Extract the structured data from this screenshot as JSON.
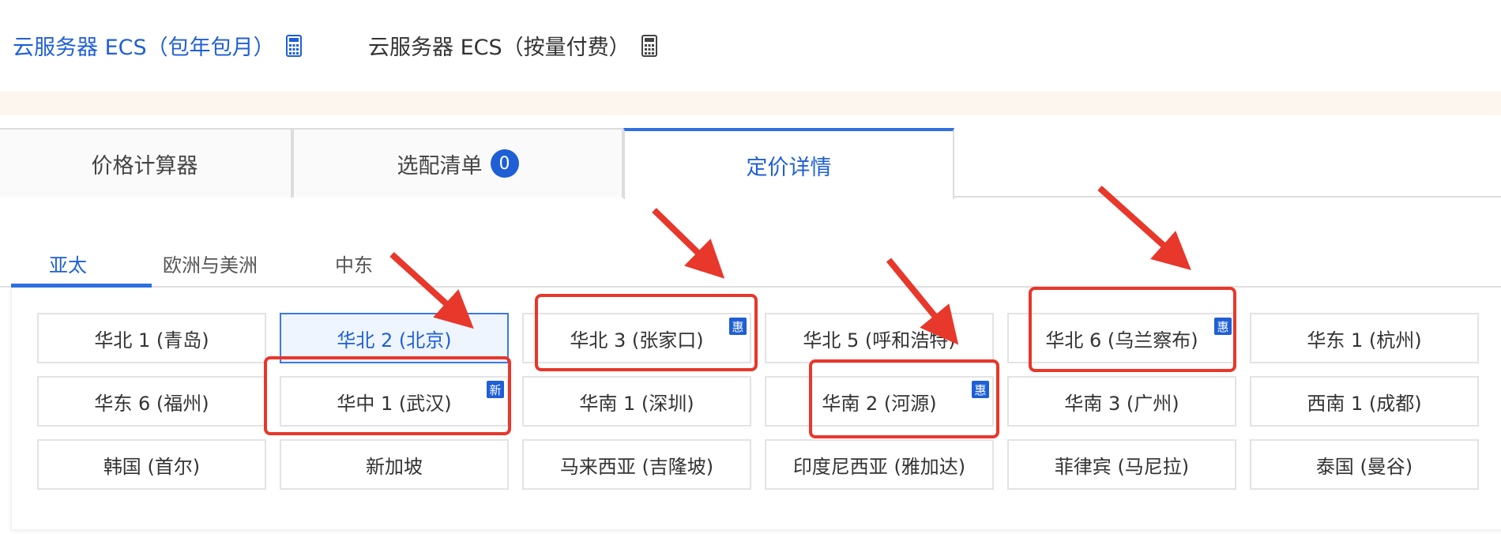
{
  "top_bar": {
    "product_1": "云服务器 ECS（包年包月）",
    "product_2": "云服务器 ECS（按量付费）"
  },
  "main_tabs": [
    {
      "label": "价格计算器"
    },
    {
      "label": "选配清单",
      "badge": "0"
    },
    {
      "label": "定价详情"
    }
  ],
  "region_tabs": [
    "亚太",
    "欧洲与美洲",
    "中东"
  ],
  "regions": [
    {
      "label": "华北 1 (青岛)"
    },
    {
      "label": "华北 2 (北京)"
    },
    {
      "label": "华北 3 (张家口)",
      "tag": "惠"
    },
    {
      "label": "华北 5 (呼和浩特)"
    },
    {
      "label": "华北 6 (乌兰察布)",
      "tag": "惠"
    },
    {
      "label": "华东 1 (杭州)"
    },
    {
      "label": "华东 6 (福州)"
    },
    {
      "label": "华中 1 (武汉)",
      "tag": "新"
    },
    {
      "label": "华南 1 (深圳)"
    },
    {
      "label": "华南 2 (河源)",
      "tag": "惠"
    },
    {
      "label": "华南 3 (广州)"
    },
    {
      "label": "西南 1 (成都)"
    },
    {
      "label": "韩国 (首尔)"
    },
    {
      "label": "新加坡"
    },
    {
      "label": "马来西亚 (吉隆坡)"
    },
    {
      "label": "印度尼西亚 (雅加达)"
    },
    {
      "label": "菲律宾 (马尼拉)"
    },
    {
      "label": "泰国 (曼谷)"
    }
  ],
  "colors": {
    "accent": "#1f5fd6",
    "annotation_red": "#e8372b",
    "notice_bg": "#fdf6ee"
  }
}
